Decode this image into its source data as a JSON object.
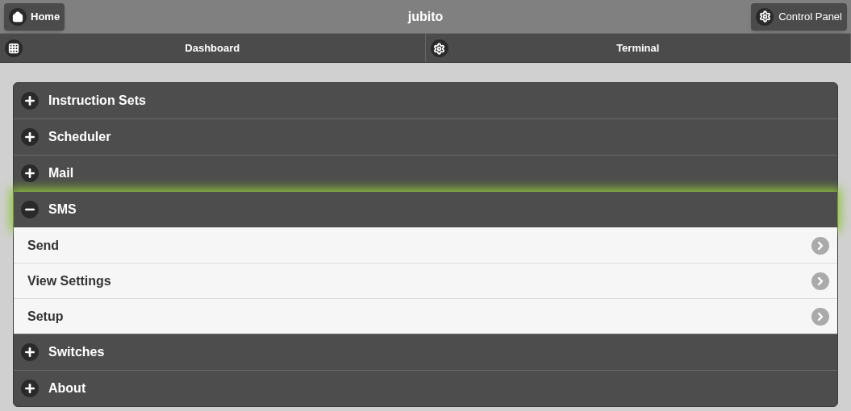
{
  "header": {
    "title": "jubito",
    "left_button": "Home",
    "right_button": "Control Panel"
  },
  "navbar": [
    {
      "label": "Dashboard",
      "kind": "grid",
      "selected": false
    },
    {
      "label": "Terminal",
      "kind": "gear",
      "selected": false
    }
  ],
  "sections": [
    {
      "title": "Instruction Sets",
      "expanded": false,
      "focused": false
    },
    {
      "title": "Scheduler",
      "expanded": false,
      "focused": false
    },
    {
      "title": "Mail",
      "expanded": false,
      "focused": false
    },
    {
      "title": "SMS",
      "expanded": true,
      "focused": true,
      "items": [
        "Send",
        "View Settings",
        "Setup"
      ]
    },
    {
      "title": "Switches",
      "expanded": false,
      "focused": false
    },
    {
      "title": "About",
      "expanded": false,
      "focused": false
    }
  ]
}
